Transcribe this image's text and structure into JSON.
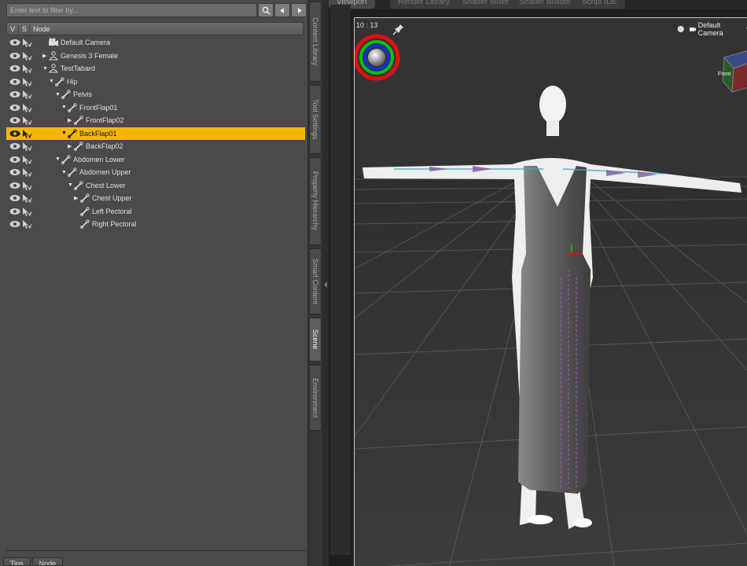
{
  "filter": {
    "placeholder": "Enter text to filter by..."
  },
  "columns": {
    "v": "V",
    "s": "S",
    "node": "Node"
  },
  "tree": [
    {
      "label": "Default Camera",
      "indent": 0,
      "arrow": "",
      "icon": "camera",
      "selected": false
    },
    {
      "label": "Genesis 3 Female",
      "indent": 0,
      "arrow": "collapsed",
      "icon": "figure",
      "selected": false
    },
    {
      "label": "TestTabard",
      "indent": 0,
      "arrow": "expanded",
      "icon": "figure",
      "selected": false
    },
    {
      "label": "Hip",
      "indent": 1,
      "arrow": "expanded",
      "icon": "bone",
      "selected": false
    },
    {
      "label": "Pelvis",
      "indent": 2,
      "arrow": "expanded",
      "icon": "bone",
      "selected": false
    },
    {
      "label": "FrontFlap01",
      "indent": 3,
      "arrow": "expanded",
      "icon": "bone",
      "selected": false
    },
    {
      "label": "FrontFlap02",
      "indent": 4,
      "arrow": "collapsed",
      "icon": "bone",
      "selected": false
    },
    {
      "label": "BackFlap01",
      "indent": 3,
      "arrow": "expanded",
      "icon": "bone",
      "selected": true
    },
    {
      "label": "BackFlap02",
      "indent": 4,
      "arrow": "collapsed",
      "icon": "bone",
      "selected": false
    },
    {
      "label": "Abdomen Lower",
      "indent": 2,
      "arrow": "expanded",
      "icon": "bone",
      "selected": false
    },
    {
      "label": "Abdomen Upper",
      "indent": 3,
      "arrow": "expanded",
      "icon": "bone",
      "selected": false
    },
    {
      "label": "Chest Lower",
      "indent": 4,
      "arrow": "expanded",
      "icon": "bone",
      "selected": false
    },
    {
      "label": "Chest Upper",
      "indent": 5,
      "arrow": "collapsed",
      "icon": "bone",
      "selected": false
    },
    {
      "label": "Left Pectoral",
      "indent": 5,
      "arrow": "",
      "icon": "bone",
      "selected": false
    },
    {
      "label": "Right Pectoral",
      "indent": 5,
      "arrow": "",
      "icon": "bone",
      "selected": false
    }
  ],
  "bottom_tabs": [
    "Tips",
    "Node"
  ],
  "side_tabs": [
    "Content Library",
    "Tool Settings",
    "Property Hierarchy",
    "Smart Content",
    "Scene",
    "Environment"
  ],
  "active_side_tab": "Scene",
  "viewport_tabs": [
    "Viewport",
    "Render Library",
    "Shader Mixer",
    "Shader Builder",
    "Script IDE"
  ],
  "active_viewport_tab": "Viewport",
  "viewport": {
    "time": "10 : 13",
    "camera": "Default Camera",
    "cube_label": "Front"
  },
  "colors": {
    "selection": "#f5b800",
    "panel": "#4a4a4a",
    "accent_red": "#e01010",
    "accent_green": "#10c010",
    "accent_blue": "#1030d0"
  }
}
